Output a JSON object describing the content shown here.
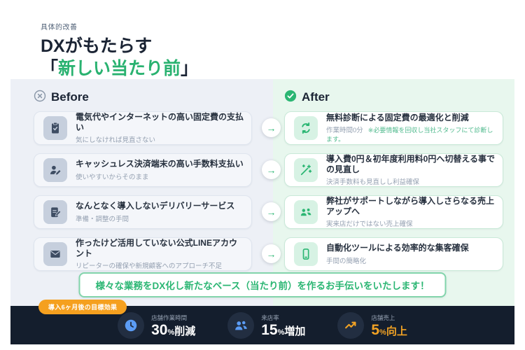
{
  "header": {
    "eyebrow": "具体的改善",
    "title_line1": "DXがもたらす",
    "bracket_open": "「",
    "title_line2_highlight": "新しい当たり前",
    "bracket_close": "」"
  },
  "before": {
    "label": "Before",
    "icon": "x-circle-icon",
    "cards": [
      {
        "icon": "clipboard-check-icon",
        "title": "電気代やインターネットの高い固定費の支払い",
        "subtitle": "気にしなければ見直さない"
      },
      {
        "icon": "user-pen-icon",
        "title": "キャッシュレス決済端末の高い手数料支払い",
        "subtitle": "使いやすいからそのまま"
      },
      {
        "icon": "clipboard-pen-icon",
        "title": "なんとなく導入しないデリバリーサービス",
        "subtitle": "準備・調整の手間"
      },
      {
        "icon": "envelope-icon",
        "title": "作ったけど活用していない公式LINEアカウント",
        "subtitle": "リピーターの確保や新規顧客へのアプローチ不足"
      }
    ]
  },
  "after": {
    "label": "After",
    "icon": "check-circle-icon",
    "cards": [
      {
        "icon": "refresh-icon",
        "title": "無料診断による固定費の最適化と削減",
        "subtitle": "作業時間0分",
        "note": "※必要情報を回収し当社スタッフにて診断します。"
      },
      {
        "icon": "magic-wand-icon",
        "title": "導入費0円＆初年度利用料0円へ切替える事での見直し",
        "subtitle": "決済手数料も見直しし利益確保",
        "note": ""
      },
      {
        "icon": "team-icon",
        "title": "弊社がサポートしながら導入しさらなる売上アップへ",
        "subtitle": "実来店だけではない売上確保",
        "note": ""
      },
      {
        "icon": "smartphone-icon",
        "title": "自動化ツールによる効率的な集客確保",
        "subtitle": "手間の簡略化",
        "note": ""
      }
    ]
  },
  "connector": {
    "arrow": "→"
  },
  "banner": {
    "text": "様々な業務をDX化し新たなベース（当たり前）を作るお手伝いをいたします！"
  },
  "footer": {
    "badge": "導入6ヶ月後の目標効果",
    "stats": [
      {
        "icon": "clock-icon",
        "label": "店舗作業時間",
        "number": "30",
        "unit": "%",
        "suffix": "削減"
      },
      {
        "icon": "users-icon",
        "label": "来店率",
        "number": "15",
        "unit": "%",
        "suffix": "増加"
      },
      {
        "icon": "trend-up-icon",
        "label": "店舗売上",
        "number": "5",
        "unit": "%",
        "suffix": "向上"
      }
    ]
  },
  "colors": {
    "accent_green": "#2bb673",
    "dark_navy": "#141e2d",
    "orange": "#f3a324",
    "blue": "#5b9cf5",
    "panel_gray": "#edf0f6",
    "panel_mint": "#e8f7ee"
  }
}
